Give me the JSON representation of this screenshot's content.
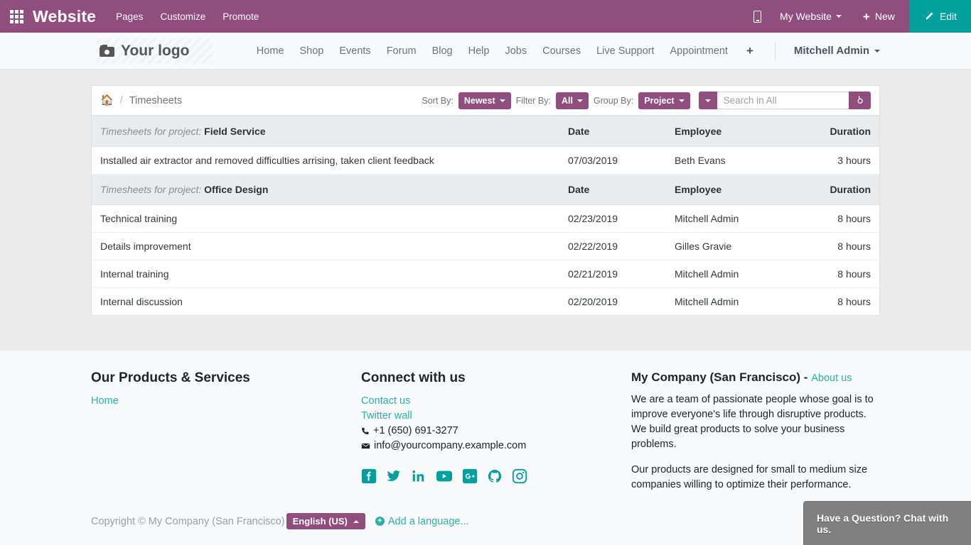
{
  "backend_bar": {
    "apps_icon": "apps-grid-icon",
    "brand": "Website",
    "menu": [
      "Pages",
      "Customize",
      "Promote"
    ],
    "mobile_preview_icon": "mobile-phone-icon",
    "site_selector": "My Website",
    "new_label": "New",
    "edit_label": "Edit",
    "bar_color": "#8f4e7e",
    "edit_color": "#00a09d"
  },
  "site_nav": {
    "logo_text": "Your logo",
    "logo_icon": "camera-icon",
    "links": [
      "Home",
      "Shop",
      "Events",
      "Forum",
      "Blog",
      "Help",
      "Jobs",
      "Courses",
      "Live Support",
      "Appointment"
    ],
    "add_page_icon": "plus-icon",
    "user": "Mitchell Admin"
  },
  "panel": {
    "breadcrumb": {
      "home_icon": "home-icon",
      "separator": "/",
      "current": "Timesheets"
    },
    "controls": {
      "sort_label": "Sort By:",
      "sort_value": "Newest",
      "filter_label": "Filter By:",
      "filter_value": "All",
      "group_label": "Group By:",
      "group_value": "Project",
      "search_scope_icon": "chevron-down-icon",
      "search_placeholder": "Search in All",
      "search_value": "",
      "search_icon": "search-icon"
    },
    "columns": [
      "Date",
      "Employee",
      "Duration"
    ],
    "group_prefix": "Timesheets for project:",
    "groups": [
      {
        "project": "Field Service",
        "rows": [
          {
            "description": "Installed air extractor and removed difficulties arrising, taken client feedback",
            "date": "07/03/2019",
            "employee": "Beth Evans",
            "duration": "3 hours"
          }
        ]
      },
      {
        "project": "Office Design",
        "rows": [
          {
            "description": "Technical training",
            "date": "02/23/2019",
            "employee": "Mitchell Admin",
            "duration": "8 hours"
          },
          {
            "description": "Details improvement",
            "date": "02/22/2019",
            "employee": "Gilles Gravie",
            "duration": "8 hours"
          },
          {
            "description": "Internal training",
            "date": "02/21/2019",
            "employee": "Mitchell Admin",
            "duration": "8 hours"
          },
          {
            "description": "Internal discussion",
            "date": "02/20/2019",
            "employee": "Mitchell Admin",
            "duration": "8 hours"
          }
        ]
      }
    ]
  },
  "footer": {
    "col1": {
      "title": "Our Products & Services",
      "links": [
        "Home"
      ]
    },
    "col2": {
      "title": "Connect with us",
      "links": [
        "Contact us",
        "Twitter wall"
      ],
      "phone": "+1 (650) 691-3277",
      "phone_icon": "phone-icon",
      "email": "info@yourcompany.example.com",
      "email_icon": "envelope-icon",
      "socials": [
        "facebook-icon",
        "twitter-icon",
        "linkedin-icon",
        "youtube-icon",
        "googleplus-icon",
        "github-icon",
        "instagram-icon"
      ],
      "social_color": "#00a09d"
    },
    "col3": {
      "title": "My Company (San Francisco)",
      "title_suffix": "-",
      "about_link": "About us",
      "paragraph1": "We are a team of passionate people whose goal is to improve everyone's life through disruptive products. We build great products to solve your business problems.",
      "paragraph2": "Our products are designed for small to medium size companies willing to optimize their performance."
    },
    "copyright": "Copyright © My Company (San Francisco)",
    "language_value": "English (US)",
    "add_language": "Add a language...",
    "link_color": "#29b2a8"
  },
  "chat": {
    "label": "Have a Question? Chat with us."
  }
}
